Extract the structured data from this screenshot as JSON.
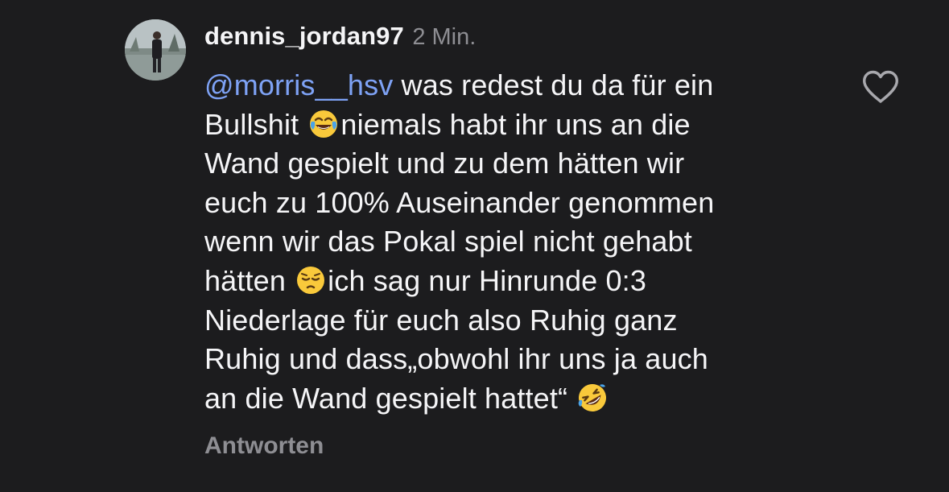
{
  "comment": {
    "username": "dennis_jordan97",
    "timestamp": "2 Min.",
    "avatar_icon": "profile-photo-person-by-lake",
    "mention": "@morris__hsv",
    "text_segments": {
      "s1": " was redest du da für ein",
      "s2": "Bullshit ",
      "s3": "niemals habt ihr uns an die",
      "s4": "Wand gespielt und zu dem hätten wir",
      "s5": "euch zu 100% Auseinander genommen",
      "s6": "wenn wir das Pokal spiel nicht gehabt",
      "s7": "hätten ",
      "s8": "ich sag nur Hinrunde 0:3",
      "s9": "Niederlage für euch also Ruhig ganz",
      "s10": "Ruhig und dass„obwohl ihr uns ja auch",
      "s11": "an die Wand gespielt hattet“ "
    },
    "emojis": [
      "face-with-tears-of-joy-icon",
      "pensive-face-icon",
      "rolling-on-floor-laughing-icon"
    ],
    "reply_label": "Antworten",
    "like_icon": "heart-outline-icon"
  },
  "colors": {
    "background": "#1c1c1e",
    "text": "#f5f5f7",
    "secondary": "#8e8e93",
    "mention": "#7ea2f5"
  }
}
